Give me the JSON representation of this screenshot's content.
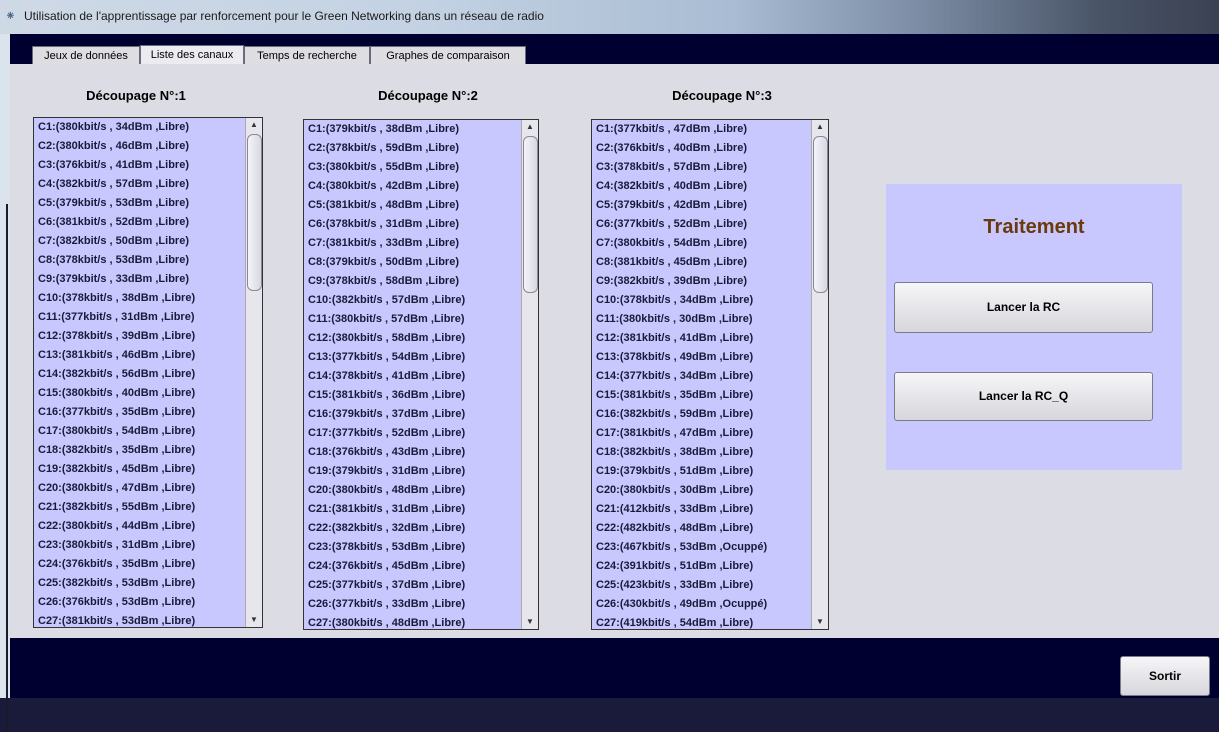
{
  "window": {
    "title": "Utilisation de l'apprentissage par renforcement pour le Green Networking dans un réseau de radio"
  },
  "tabs": [
    {
      "label": "Jeux de données"
    },
    {
      "label": "Liste des canaux"
    },
    {
      "label": "Temps de recherche"
    },
    {
      "label": "Graphes de comparaison"
    }
  ],
  "active_tab": "Liste des canaux",
  "columns": [
    {
      "title": "Découpage N°:1",
      "items": [
        "C1:(380kbit/s , 34dBm ,Libre)",
        "C2:(380kbit/s , 46dBm ,Libre)",
        "C3:(376kbit/s , 41dBm ,Libre)",
        "C4:(382kbit/s , 57dBm ,Libre)",
        "C5:(379kbit/s , 53dBm ,Libre)",
        "C6:(381kbit/s , 52dBm ,Libre)",
        "C7:(382kbit/s , 50dBm ,Libre)",
        "C8:(378kbit/s , 53dBm ,Libre)",
        "C9:(379kbit/s , 33dBm ,Libre)",
        "C10:(378kbit/s , 38dBm ,Libre)",
        "C11:(377kbit/s , 31dBm ,Libre)",
        "C12:(378kbit/s , 39dBm ,Libre)",
        "C13:(381kbit/s , 46dBm ,Libre)",
        "C14:(382kbit/s , 56dBm ,Libre)",
        "C15:(380kbit/s , 40dBm ,Libre)",
        "C16:(377kbit/s , 35dBm ,Libre)",
        "C17:(380kbit/s , 54dBm ,Libre)",
        "C18:(382kbit/s , 35dBm ,Libre)",
        "C19:(382kbit/s , 45dBm ,Libre)",
        "C20:(380kbit/s , 47dBm ,Libre)",
        "C21:(382kbit/s , 55dBm ,Libre)",
        "C22:(380kbit/s , 44dBm ,Libre)",
        "C23:(380kbit/s , 31dBm ,Libre)",
        "C24:(376kbit/s , 35dBm ,Libre)",
        "C25:(382kbit/s , 53dBm ,Libre)",
        "C26:(376kbit/s , 53dBm ,Libre)",
        "C27:(381kbit/s , 53dBm ,Libre)"
      ]
    },
    {
      "title": "Découpage N°:2",
      "items": [
        "C1:(379kbit/s , 38dBm ,Libre)",
        "C2:(378kbit/s , 59dBm ,Libre)",
        "C3:(380kbit/s , 55dBm ,Libre)",
        "C4:(380kbit/s , 42dBm ,Libre)",
        "C5:(381kbit/s , 48dBm ,Libre)",
        "C6:(378kbit/s , 31dBm ,Libre)",
        "C7:(381kbit/s , 33dBm ,Libre)",
        "C8:(379kbit/s , 50dBm ,Libre)",
        "C9:(378kbit/s , 58dBm ,Libre)",
        "C10:(382kbit/s , 57dBm ,Libre)",
        "C11:(380kbit/s , 57dBm ,Libre)",
        "C12:(380kbit/s , 58dBm ,Libre)",
        "C13:(377kbit/s , 54dBm ,Libre)",
        "C14:(378kbit/s , 41dBm ,Libre)",
        "C15:(381kbit/s , 36dBm ,Libre)",
        "C16:(379kbit/s , 37dBm ,Libre)",
        "C17:(377kbit/s , 52dBm ,Libre)",
        "C18:(376kbit/s , 43dBm ,Libre)",
        "C19:(379kbit/s , 31dBm ,Libre)",
        "C20:(380kbit/s , 48dBm ,Libre)",
        "C21:(381kbit/s , 31dBm ,Libre)",
        "C22:(382kbit/s , 32dBm ,Libre)",
        "C23:(378kbit/s , 53dBm ,Libre)",
        "C24:(376kbit/s , 45dBm ,Libre)",
        "C25:(377kbit/s , 37dBm ,Libre)",
        "C26:(377kbit/s , 33dBm ,Libre)",
        "C27:(380kbit/s , 48dBm ,Libre)"
      ]
    },
    {
      "title": "Découpage N°:3",
      "items": [
        "C1:(377kbit/s , 47dBm ,Libre)",
        "C2:(376kbit/s , 40dBm ,Libre)",
        "C3:(378kbit/s , 57dBm ,Libre)",
        "C4:(382kbit/s , 40dBm ,Libre)",
        "C5:(379kbit/s , 42dBm ,Libre)",
        "C6:(377kbit/s , 52dBm ,Libre)",
        "C7:(380kbit/s , 54dBm ,Libre)",
        "C8:(381kbit/s , 45dBm ,Libre)",
        "C9:(382kbit/s , 39dBm ,Libre)",
        "C10:(378kbit/s , 34dBm ,Libre)",
        "C11:(380kbit/s , 30dBm ,Libre)",
        "C12:(381kbit/s , 41dBm ,Libre)",
        "C13:(378kbit/s , 49dBm ,Libre)",
        "C14:(377kbit/s , 34dBm ,Libre)",
        "C15:(381kbit/s , 35dBm ,Libre)",
        "C16:(382kbit/s , 59dBm ,Libre)",
        "C17:(381kbit/s , 47dBm ,Libre)",
        "C18:(382kbit/s , 38dBm ,Libre)",
        "C19:(379kbit/s , 51dBm ,Libre)",
        "C20:(380kbit/s , 30dBm ,Libre)",
        "C21:(412kbit/s , 33dBm ,Libre)",
        "C22:(482kbit/s , 48dBm ,Libre)",
        "C23:(467kbit/s , 53dBm ,Ocuppé)",
        "C24:(391kbit/s , 51dBm ,Libre)",
        "C25:(423kbit/s , 33dBm ,Libre)",
        "C26:(430kbit/s , 49dBm ,Ocuppé)",
        "C27:(419kbit/s , 54dBm ,Libre)"
      ]
    }
  ],
  "panel": {
    "heading": "Traitement",
    "buttons": [
      "Lancer la RC",
      "Lancer la RC_Q"
    ]
  },
  "footer": {
    "exit_label": "Sortir"
  },
  "icons": {
    "app": "radio-network-icon",
    "scroll_up": "arrow-up-icon",
    "scroll_down": "arrow-down-icon"
  }
}
